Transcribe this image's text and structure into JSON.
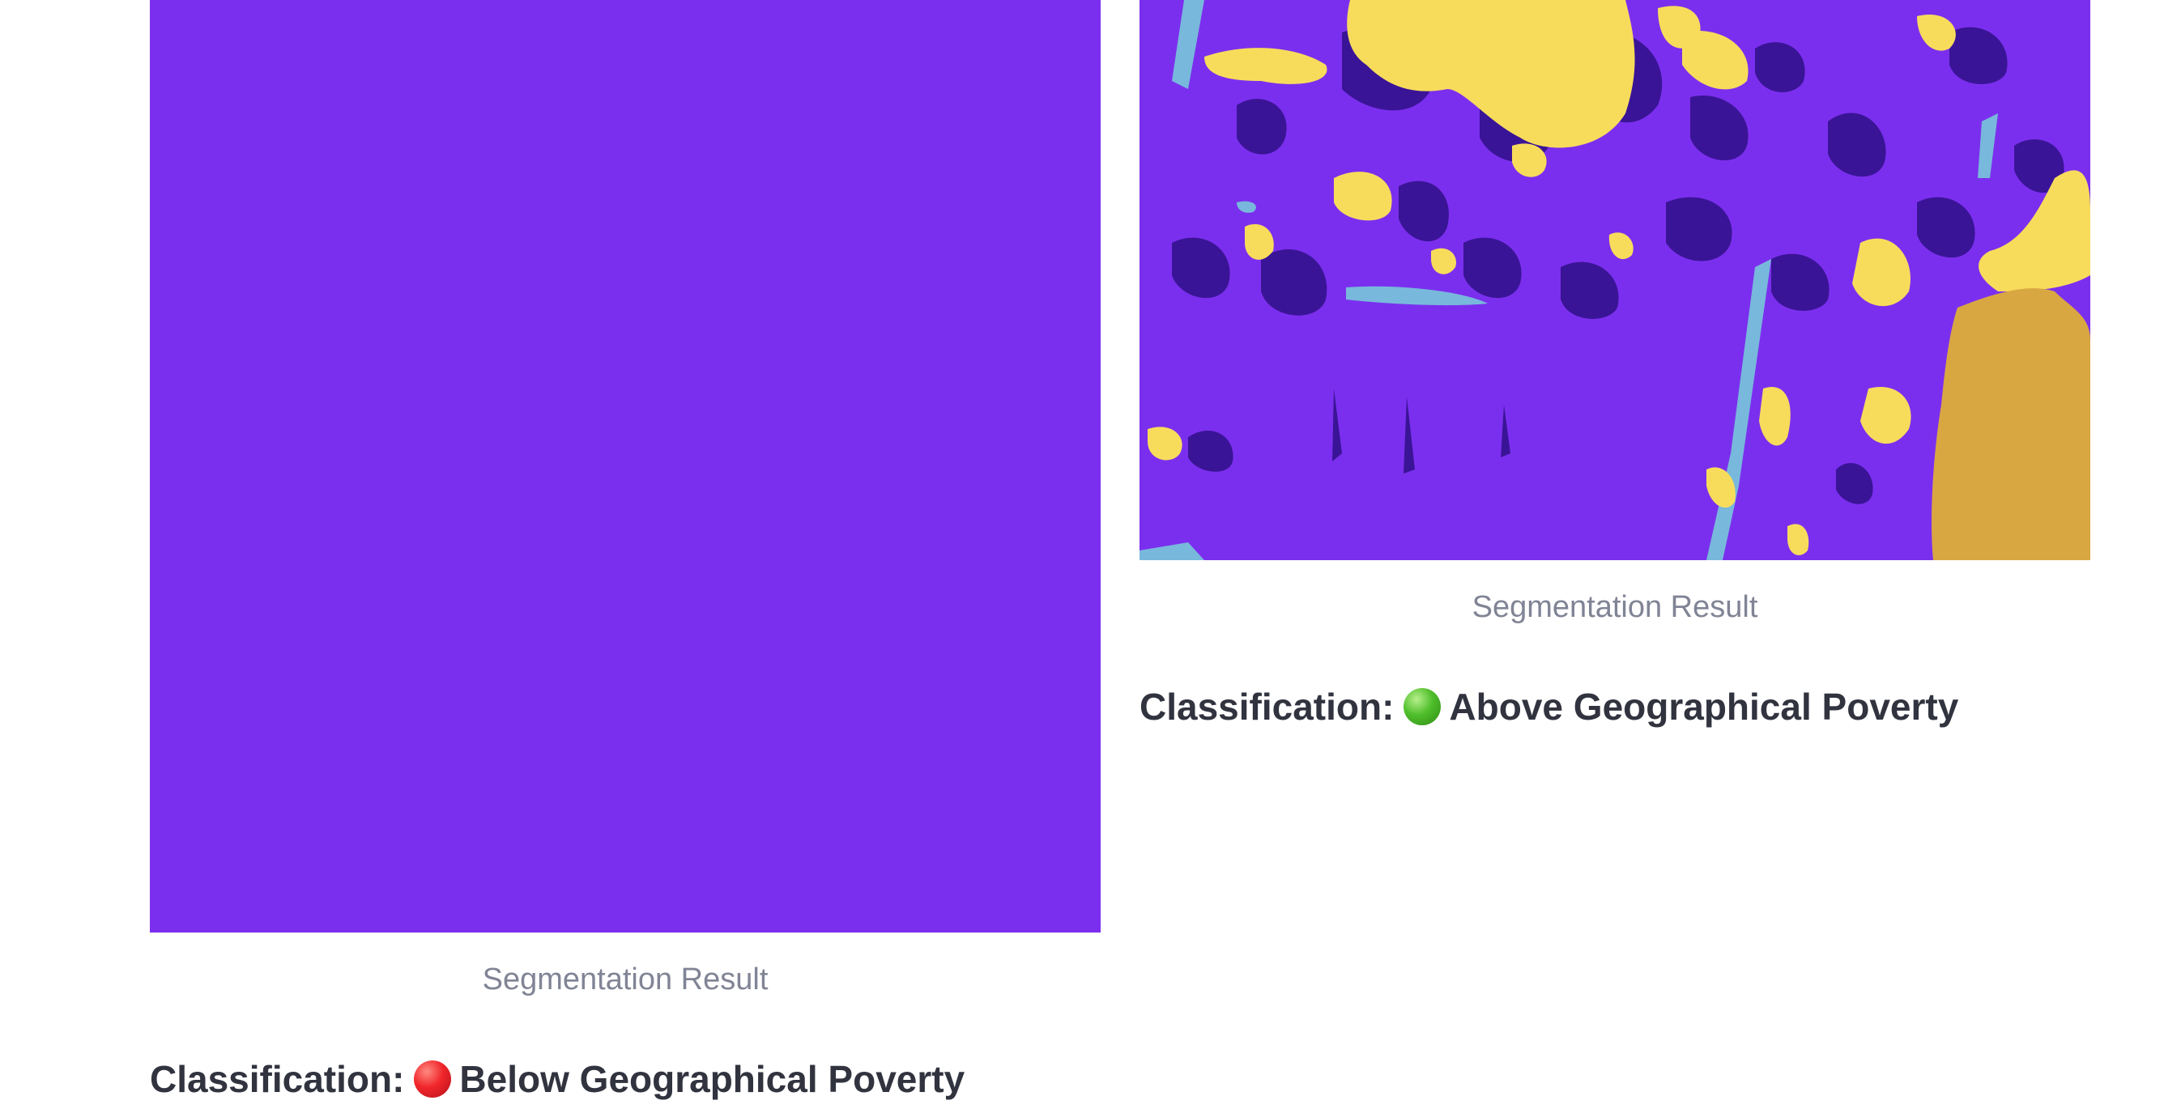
{
  "results": [
    {
      "caption": "Segmentation Result",
      "classification_label": "Classification:",
      "classification_value": "Below Geographical Poverty",
      "status_icon": "red-circle-icon",
      "status_color": "#e8212a"
    },
    {
      "caption": "Segmentation Result",
      "classification_label": "Classification:",
      "classification_value": "Above Geographical Poverty",
      "status_icon": "green-circle-icon",
      "status_color": "#3fae29"
    }
  ],
  "colors": {
    "segment_background": "#7b2fee",
    "segment_dark": "#3a1496",
    "segment_yellow": "#f7dc5c",
    "segment_orange": "#d9a742",
    "segment_light_blue": "#78b8dc"
  }
}
